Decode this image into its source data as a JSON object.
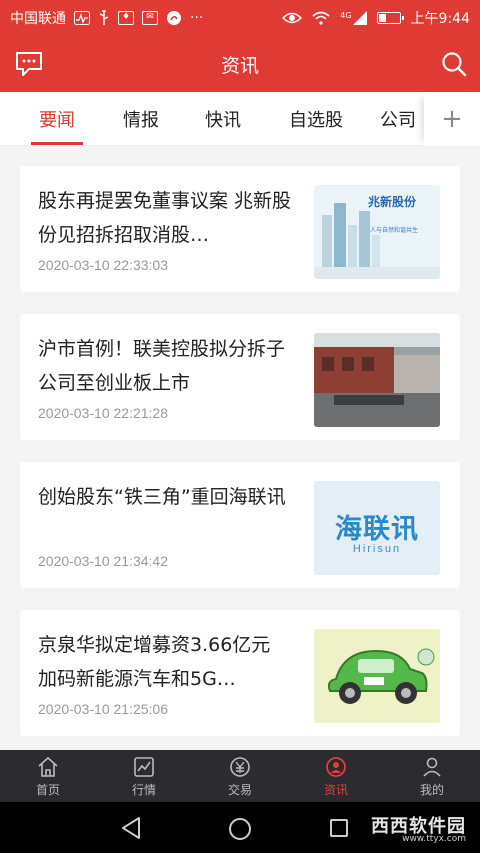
{
  "status_bar": {
    "carrier": "中国联通",
    "icons": [
      "activity-icon",
      "usb-icon",
      "app-icon",
      "mail-icon",
      "weibo-icon",
      "more-dots-icon"
    ],
    "more": "···",
    "network": "4G",
    "battery_level": 0.35,
    "time": "上午9:44"
  },
  "header": {
    "title": "资讯",
    "left_icon": "message-icon",
    "right_icon": "search-icon"
  },
  "tabs": [
    {
      "label": "要闻",
      "active": true
    },
    {
      "label": "情报",
      "active": false
    },
    {
      "label": "快讯",
      "active": false
    },
    {
      "label": "自选股",
      "active": false
    },
    {
      "label": "公司",
      "active": false
    }
  ],
  "tab_add": "+",
  "news": [
    {
      "headline": "股东再提罢免董事议案 兆新股份见招拆招取消股…",
      "time": "2020-03-10 22:33:03",
      "thumb_text": "兆新股份",
      "thumb_sub": "人与自然和谐共生"
    },
    {
      "headline": "沪市首例！联美控股拟分拆子公司至创业板上市",
      "time": "2020-03-10 22:21:28"
    },
    {
      "headline": "创始股东“铁三角”重回海联讯",
      "time": "2020-03-10 21:34:42",
      "thumb_text": "海联讯",
      "thumb_sub": "Hirisun"
    },
    {
      "headline": "京泉华拟定增募资3.66亿元 加码新能源汽车和5G…",
      "time": "2020-03-10 21:25:06"
    }
  ],
  "bottom_nav": [
    {
      "label": "首页",
      "icon": "home-icon",
      "active": false
    },
    {
      "label": "行情",
      "icon": "chart-icon",
      "active": false
    },
    {
      "label": "交易",
      "icon": "trade-icon",
      "active": false
    },
    {
      "label": "资讯",
      "icon": "news-icon",
      "active": true
    },
    {
      "label": "我的",
      "icon": "profile-icon",
      "active": false
    }
  ],
  "watermark": {
    "text": "西西软件园",
    "sub": "www.ttyx.com"
  },
  "colors": {
    "brand_red": "#e03a35",
    "accent_red": "#d63c33",
    "nav_bg": "#2c2c30"
  }
}
